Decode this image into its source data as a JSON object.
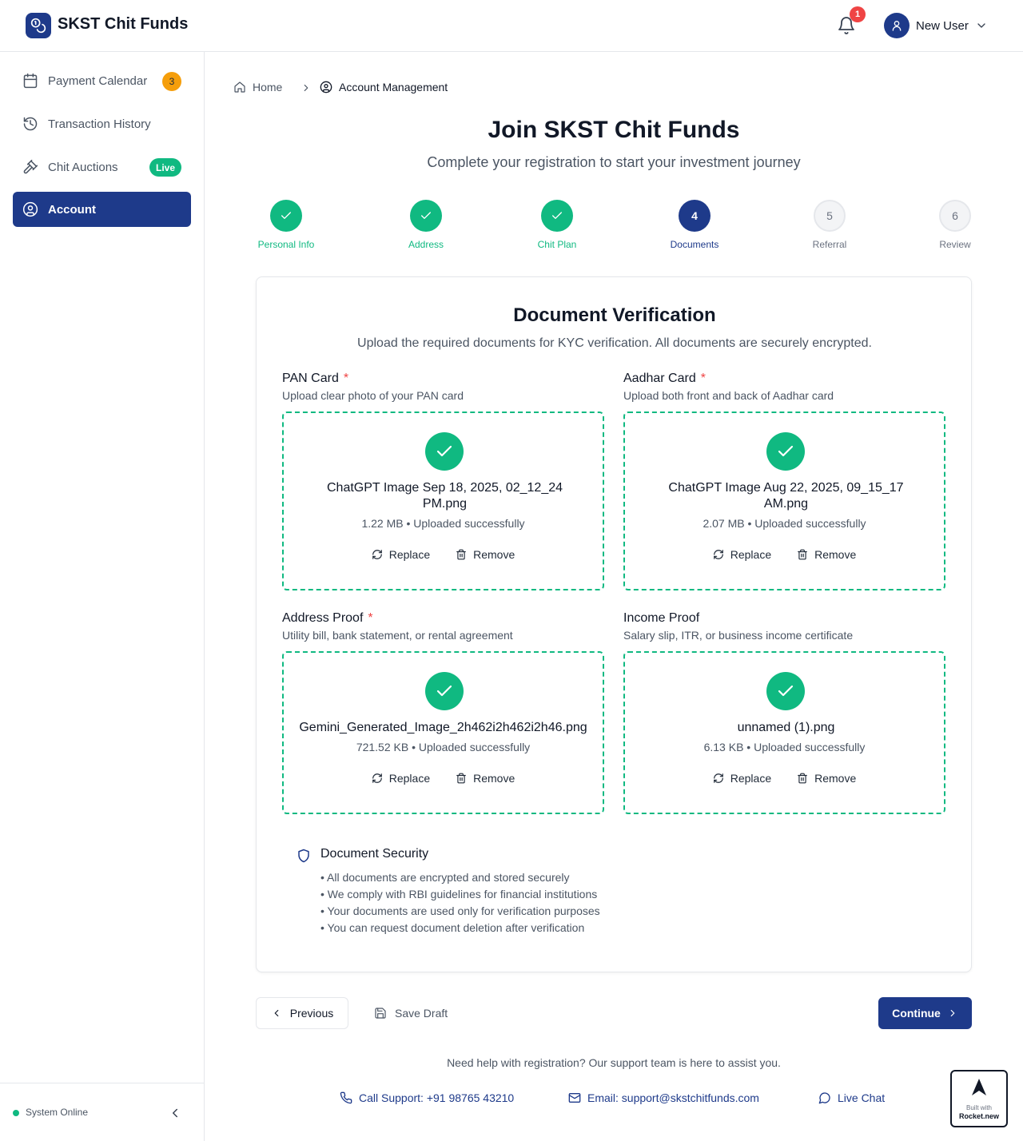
{
  "header": {
    "brand": "SKST Chit Funds",
    "notification_count": "1",
    "user_name": "New User"
  },
  "sidebar": {
    "items": [
      {
        "label": "Payment Calendar",
        "badge": "3",
        "icon": "calendar-icon"
      },
      {
        "label": "Transaction History",
        "icon": "history-icon"
      },
      {
        "label": "Chit Auctions",
        "badge": "Live",
        "icon": "gavel-icon"
      },
      {
        "label": "Account",
        "icon": "user-circle-icon",
        "active": true
      }
    ],
    "status": "System Online"
  },
  "breadcrumb": {
    "home": "Home",
    "current": "Account Management"
  },
  "page": {
    "title": "Join SKST Chit Funds",
    "subtitle": "Complete your registration to start your investment journey"
  },
  "steps": [
    {
      "number": "1",
      "label": "Personal Info",
      "state": "done"
    },
    {
      "number": "2",
      "label": "Address",
      "state": "done"
    },
    {
      "number": "3",
      "label": "Chit Plan",
      "state": "done"
    },
    {
      "number": "4",
      "label": "Documents",
      "state": "current"
    },
    {
      "number": "5",
      "label": "Referral",
      "state": "todo"
    },
    {
      "number": "6",
      "label": "Review",
      "state": "todo"
    }
  ],
  "card": {
    "title": "Document Verification",
    "subtitle": "Upload the required documents for KYC verification. All documents are securely encrypted.",
    "documents": [
      {
        "title": "PAN Card",
        "required": "*",
        "description": "Upload clear photo of your PAN card",
        "file_line1": "ChatGPT Image Sep 18, 2025, 02_12_24",
        "file_line2": "PM.png",
        "meta": "1.22 MB • Uploaded successfully"
      },
      {
        "title": "Aadhar Card",
        "required": "*",
        "description": "Upload both front and back of Aadhar card",
        "file_line1": "ChatGPT Image Aug 22, 2025, 09_15_17",
        "file_line2": "AM.png",
        "meta": "2.07 MB • Uploaded successfully"
      },
      {
        "title": "Address Proof",
        "required": "*",
        "description": "Utility bill, bank statement, or rental agreement",
        "file_line1": "Gemini_Generated_Image_2h462i2h462i2h46.png",
        "meta": "721.52 KB • Uploaded successfully"
      },
      {
        "title": "Income Proof",
        "description": "Salary slip, ITR, or business income certificate",
        "file_line1": "unnamed (1).png",
        "meta": "6.13 KB • Uploaded successfully"
      }
    ],
    "replace_label": "Replace",
    "remove_label": "Remove",
    "security": {
      "title": "Document Security",
      "points": [
        "All documents are encrypted and stored securely",
        "We comply with RBI guidelines for financial institutions",
        "Your documents are used only for verification purposes",
        "You can request document deletion after verification"
      ]
    }
  },
  "footer_buttons": {
    "previous": "Previous",
    "save_draft": "Save Draft",
    "continue": "Continue"
  },
  "support": {
    "help_text": "Need help with registration? Our support team is here to assist you.",
    "call": "Call Support: +91 98765 43210",
    "email": "Email: support@skstchitfunds.com",
    "chat": "Live Chat"
  },
  "rocket_badge": {
    "line1": "Built with",
    "line2": "Rocket.new"
  },
  "colors": {
    "primary": "#1e3a8a",
    "success": "#10b981",
    "warning": "#f59e0b",
    "danger": "#ef4444"
  }
}
